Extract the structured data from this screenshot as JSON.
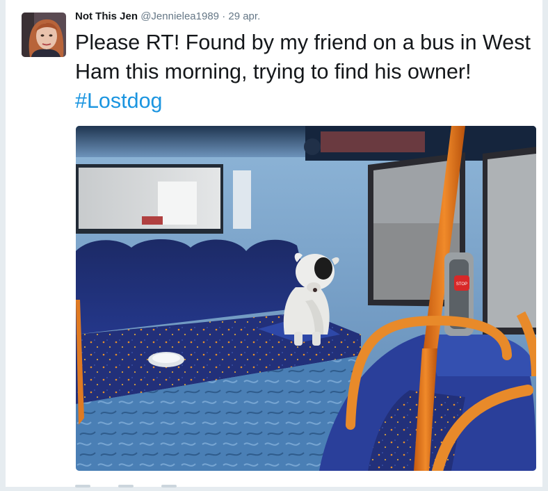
{
  "tweet": {
    "name": "Not This Jen",
    "handle": "@Jennielea1989",
    "separator": "·",
    "date": "29 apr.",
    "text_main": "Please RT! Found by my friend on a bus in West Ham this morning, trying to find his owner! ",
    "hashtag": "#Lostdog",
    "hashtag_color": "#1b95e0"
  },
  "photo": {
    "stop_label": "STOP"
  },
  "icons": [
    "avatar",
    "reply-icon",
    "retweet-icon",
    "like-icon"
  ]
}
